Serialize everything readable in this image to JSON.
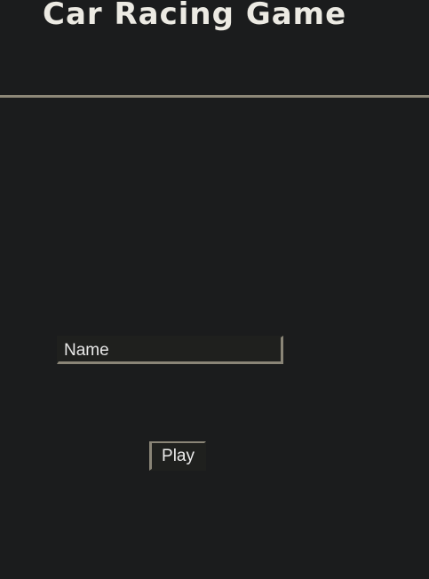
{
  "header": {
    "title": "Car Racing Game"
  },
  "form": {
    "name_placeholder": "Name",
    "name_value": "",
    "play_label": "Play"
  },
  "colors": {
    "background": "#1b1c1d",
    "divider": "#8d8778",
    "title_text": "#eceae3",
    "control_background": "#1f201e",
    "control_border": "#8a8577"
  }
}
